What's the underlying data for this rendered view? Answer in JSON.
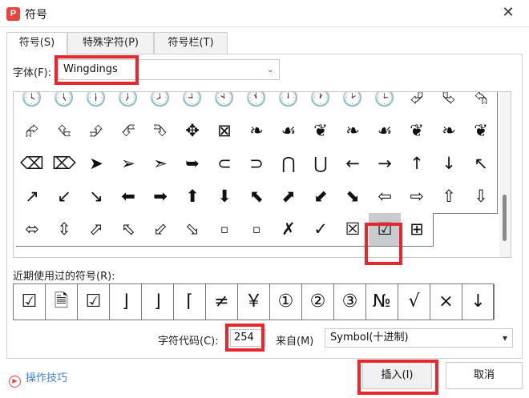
{
  "window": {
    "title": "符号",
    "app_icon_letter": "P",
    "close_glyph": "✕"
  },
  "tabs": [
    {
      "label": "符号(S)"
    },
    {
      "label": "特殊字符(P)"
    },
    {
      "label": "符号栏(T)"
    }
  ],
  "font": {
    "label": "字体(F):",
    "value": "Wingdings",
    "arrow": "⌄"
  },
  "grid": {
    "rows": [
      [
        "🕓",
        "🕔",
        "🕕",
        "🕖",
        "🕗",
        "🕘",
        "🕙",
        "🕚",
        "🕛",
        "🕐",
        "🕑",
        "🕒",
        "⮰",
        "⮱",
        "⮲"
      ],
      [
        "⮳",
        "⮴",
        "⮵",
        "⮶",
        "⮷",
        "✥",
        "⊠",
        "❧",
        "☙",
        "❦",
        "❧",
        "☙",
        "❦",
        "❧",
        "❦"
      ],
      [
        "⌫",
        "⌦",
        "➤",
        "➢",
        "➣",
        "➥",
        "⊂",
        "⊃",
        "⋂",
        "⋃",
        "←",
        "→",
        "↑",
        "↓",
        "↖"
      ],
      [
        "↗",
        "↙",
        "↘",
        "⬅",
        "➡",
        "⬆",
        "⬇",
        "⬉",
        "⬈",
        "⬋",
        "⬊",
        "⇦",
        "⇨",
        "⇧",
        "⇩"
      ],
      [
        "⬄",
        "⇳",
        "⬀",
        "⬁",
        "⬃",
        "⬂",
        "▫",
        "▫",
        "✗",
        "✓",
        "☒",
        "☑",
        "⊞"
      ]
    ],
    "selected_symbol": "☑"
  },
  "recent": {
    "label": "近期使用过的符号(R):",
    "items": [
      "☑",
      "🗎",
      "☑",
      "⌋",
      "⌋",
      "⌈",
      "≠",
      "￥",
      "①",
      "②",
      "③",
      "№",
      "√",
      "×",
      "↓"
    ]
  },
  "char_code": {
    "label": "字符代码(C):",
    "value": "254"
  },
  "from": {
    "label": "来自(M)",
    "value": "Symbol(十进制)",
    "arrow": "▾"
  },
  "help": {
    "label": "操作技巧",
    "icon_glyph": "▶"
  },
  "buttons": {
    "insert": "插入(I)",
    "cancel": "取消"
  },
  "colors": {
    "highlight": "#e8262d",
    "link": "#3f84d6",
    "app_icon": "#e8473f"
  }
}
